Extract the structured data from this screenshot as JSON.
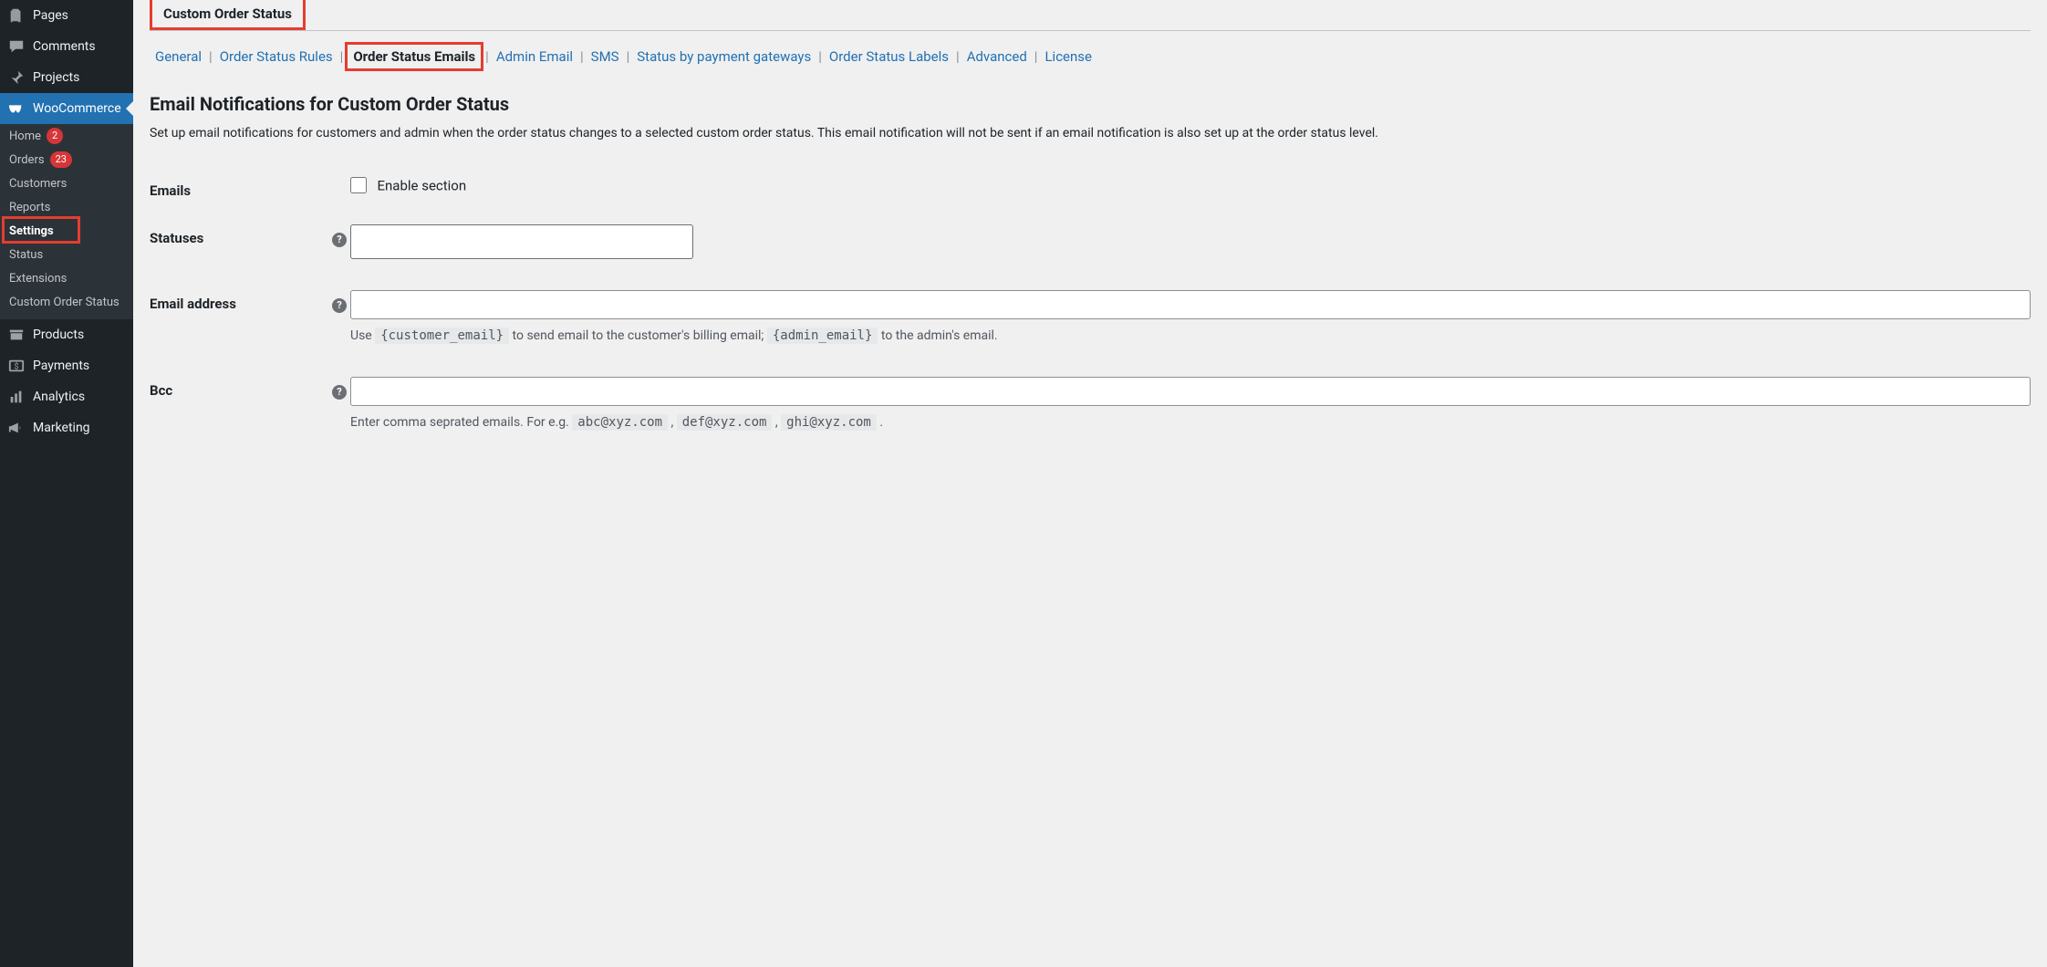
{
  "sidebar": {
    "top_items": [
      {
        "name": "pages",
        "label": "Pages",
        "icon": "pages"
      },
      {
        "name": "comments",
        "label": "Comments",
        "icon": "comment"
      },
      {
        "name": "projects",
        "label": "Projects",
        "icon": "pin"
      },
      {
        "name": "woocommerce",
        "label": "WooCommerce",
        "icon": "woo",
        "active": true
      }
    ],
    "woo_sub": [
      {
        "name": "home",
        "label": "Home",
        "badge": "2"
      },
      {
        "name": "orders",
        "label": "Orders",
        "badge": "23"
      },
      {
        "name": "customers",
        "label": "Customers"
      },
      {
        "name": "reports",
        "label": "Reports"
      },
      {
        "name": "settings",
        "label": "Settings",
        "current": true
      },
      {
        "name": "status",
        "label": "Status"
      },
      {
        "name": "extensions",
        "label": "Extensions"
      },
      {
        "name": "custom-order-status",
        "label": "Custom Order Status"
      }
    ],
    "bottom_items": [
      {
        "name": "products",
        "label": "Products",
        "icon": "archive"
      },
      {
        "name": "payments",
        "label": "Payments",
        "icon": "dollar"
      },
      {
        "name": "analytics",
        "label": "Analytics",
        "icon": "bars"
      },
      {
        "name": "marketing",
        "label": "Marketing",
        "icon": "megaphone"
      }
    ]
  },
  "tabs": {
    "top": "Custom Order Status",
    "sub": [
      {
        "label": "General",
        "name": "general"
      },
      {
        "label": "Order Status Rules",
        "name": "rules"
      },
      {
        "label": "Order Status Emails",
        "name": "emails",
        "active": true
      },
      {
        "label": "Admin Email",
        "name": "admin"
      },
      {
        "label": "SMS",
        "name": "sms"
      },
      {
        "label": "Status by payment gateways",
        "name": "gateways"
      },
      {
        "label": "Order Status Labels",
        "name": "labels"
      },
      {
        "label": "Advanced",
        "name": "advanced"
      },
      {
        "label": "License",
        "name": "license"
      }
    ]
  },
  "page": {
    "title": "Email Notifications for Custom Order Status",
    "description": "Set up email notifications for customers and admin when the order status changes to a selected custom order status. This email notification will not be sent if an email notification is also set up at the order status level."
  },
  "form": {
    "emails_label": "Emails",
    "enable_section_label": "Enable section",
    "statuses_label": "Statuses",
    "email_address_label": "Email address",
    "email_address_desc_pre": "Use ",
    "email_address_code_customer": "{customer_email}",
    "email_address_desc_mid": " to send email to the customer's billing email; ",
    "email_address_code_admin": "{admin_email}",
    "email_address_desc_post": " to the admin's email.",
    "bcc_label": "Bcc",
    "bcc_desc_pre": "Enter comma seprated emails. For e.g. ",
    "bcc_ex1": "abc@xyz.com",
    "bcc_sep": " , ",
    "bcc_ex2": "def@xyz.com",
    "bcc_ex3": "ghi@xyz.com",
    "bcc_desc_post": " ."
  }
}
